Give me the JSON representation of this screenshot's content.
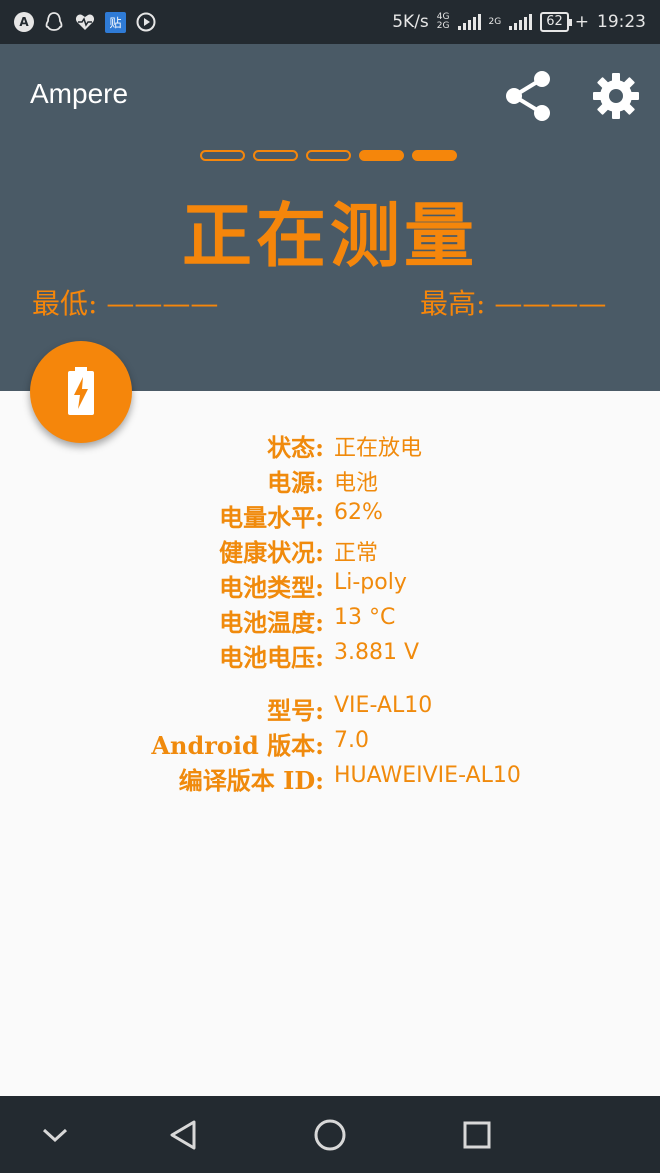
{
  "status_bar": {
    "left_icons": [
      "a-circle-icon",
      "qq-icon",
      "heart-icon",
      "sticker-icon",
      "video-icon"
    ],
    "app_badge": "贴",
    "net_speed": "5K/s",
    "net1_top": "4G",
    "net1_bottom": "2G",
    "net2_top": "2G",
    "battery": "62",
    "time": "19:23"
  },
  "header": {
    "app_title": "Ampere",
    "headline": "正在测量",
    "progress_dots": [
      false,
      false,
      false,
      true,
      true
    ],
    "min_label": "最低: ————",
    "max_label": "最高: ————"
  },
  "info": {
    "status_label": "状态:",
    "status_value": "正在放电",
    "power_label": "电源:",
    "power_value": "电池",
    "level_label": "电量水平:",
    "level_value": "62%",
    "health_label": "健康状况:",
    "health_value": "正常",
    "type_label": "电池类型:",
    "type_value": "Li-poly",
    "temp_label": "电池温度:",
    "temp_value": "13 °C",
    "voltage_label": "电池电压:",
    "voltage_value": "3.881 V",
    "model_label": "型号:",
    "model_value": "VIE-AL10",
    "android_label": "Android 版本:",
    "android_value": "7.0",
    "build_label": "编译版本 ID:",
    "build_value": "HUAWEIVIE-AL10"
  },
  "colors": {
    "accent": "#f5860b",
    "header_bg": "#4a5a66",
    "bar_bg": "#232a30"
  }
}
